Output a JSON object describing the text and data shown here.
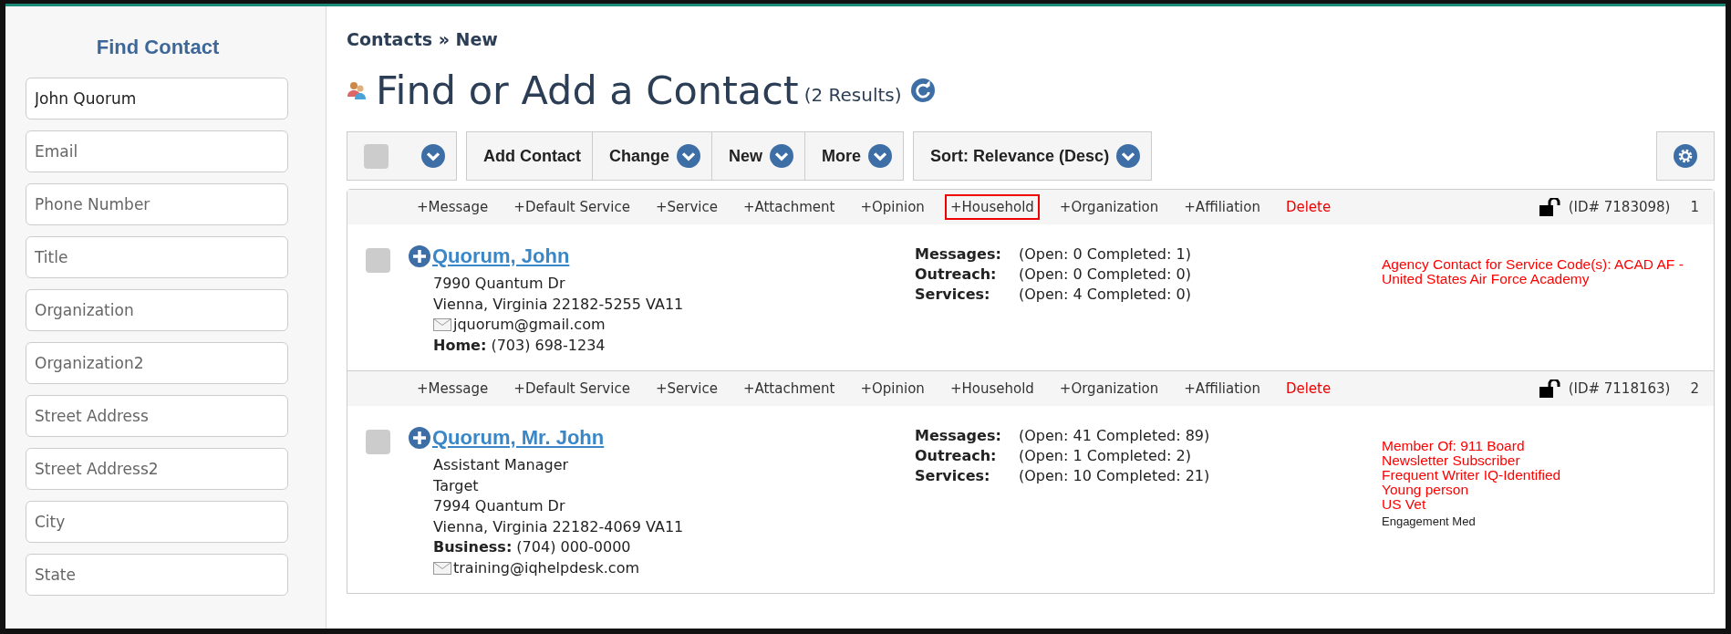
{
  "sidebar": {
    "title": "Find Contact",
    "fields": [
      {
        "value": "John Quorum"
      },
      {
        "placeholder": "Email"
      },
      {
        "placeholder": "Phone Number"
      },
      {
        "placeholder": "Title"
      },
      {
        "placeholder": "Organization"
      },
      {
        "placeholder": "Organization2"
      },
      {
        "placeholder": "Street Address"
      },
      {
        "placeholder": "Street Address2"
      },
      {
        "placeholder": "City"
      },
      {
        "placeholder": "State"
      }
    ]
  },
  "breadcrumb": "Contacts » New",
  "page_title": "Find or Add a Contact",
  "result_count": "(2 Results)",
  "toolbar": {
    "select_all_checked": false,
    "buttons": [
      {
        "label": "Add Contact",
        "dropdown": false
      },
      {
        "label": "Change",
        "dropdown": true
      },
      {
        "label": "New",
        "dropdown": true
      },
      {
        "label": "More",
        "dropdown": true
      }
    ],
    "sort": "Sort: Relevance (Desc)"
  },
  "contacts": [
    {
      "actions": [
        {
          "label": "+Message",
          "kind": "add",
          "highlighted": false
        },
        {
          "label": "+Default Service",
          "kind": "add",
          "highlighted": false
        },
        {
          "label": "+Service",
          "kind": "add",
          "highlighted": false
        },
        {
          "label": "+Attachment",
          "kind": "add",
          "highlighted": false
        },
        {
          "label": "+Opinion",
          "kind": "add",
          "highlighted": false
        },
        {
          "label": "+Household",
          "kind": "add",
          "highlighted": true
        },
        {
          "label": "+Organization",
          "kind": "add",
          "highlighted": false
        },
        {
          "label": "+Affiliation",
          "kind": "add",
          "highlighted": false
        },
        {
          "label": "Delete",
          "kind": "delete",
          "highlighted": false
        }
      ],
      "id": "(ID# 7183098)",
      "index": "1",
      "checked": false,
      "name": "Quorum, John",
      "details": [
        {
          "kind": "text",
          "text": "7990 Quantum Dr"
        },
        {
          "kind": "text",
          "text": "Vienna, Virginia 22182-5255 VA11"
        },
        {
          "kind": "email",
          "text": "jquorum@gmail.com"
        },
        {
          "kind": "phone",
          "label": "Home:",
          "text": "(703) 698-1234"
        }
      ],
      "stats": [
        {
          "label": "Messages:",
          "value": "(Open: 0 Completed: 1)"
        },
        {
          "label": "Outreach:",
          "value": "(Open: 0 Completed: 0)"
        },
        {
          "label": "Services:",
          "value": "(Open: 4 Completed: 0)"
        }
      ],
      "flags": [
        {
          "kind": "alert",
          "text": "Agency Contact for Service Code(s): ACAD AF - United States Air Force Academy"
        }
      ]
    },
    {
      "actions": [
        {
          "label": "+Message",
          "kind": "add",
          "highlighted": false
        },
        {
          "label": "+Default Service",
          "kind": "add",
          "highlighted": false
        },
        {
          "label": "+Service",
          "kind": "add",
          "highlighted": false
        },
        {
          "label": "+Attachment",
          "kind": "add",
          "highlighted": false
        },
        {
          "label": "+Opinion",
          "kind": "add",
          "highlighted": false
        },
        {
          "label": "+Household",
          "kind": "add",
          "highlighted": false
        },
        {
          "label": "+Organization",
          "kind": "add",
          "highlighted": false
        },
        {
          "label": "+Affiliation",
          "kind": "add",
          "highlighted": false
        },
        {
          "label": "Delete",
          "kind": "delete",
          "highlighted": false
        }
      ],
      "id": "(ID# 7118163)",
      "index": "2",
      "checked": false,
      "name": "Quorum, Mr. John",
      "details": [
        {
          "kind": "text",
          "text": "Assistant Manager"
        },
        {
          "kind": "text",
          "text": "Target"
        },
        {
          "kind": "text",
          "text": "7994 Quantum Dr"
        },
        {
          "kind": "text",
          "text": "Vienna, Virginia 22182-4069 VA11"
        },
        {
          "kind": "phone",
          "label": "Business:",
          "text": "(704) 000-0000"
        },
        {
          "kind": "email",
          "text": "training@iqhelpdesk.com"
        }
      ],
      "stats": [
        {
          "label": "Messages:",
          "value": "(Open: 41 Completed: 89)"
        },
        {
          "label": "Outreach:",
          "value": "(Open: 1 Completed: 2)"
        },
        {
          "label": "Services:",
          "value": "(Open: 10 Completed: 21)"
        }
      ],
      "flags": [
        {
          "kind": "alert",
          "text": "Member Of: 911 Board"
        },
        {
          "kind": "alert",
          "text": "Newsletter Subscriber"
        },
        {
          "kind": "alert",
          "text": "Frequent Writer IQ-Identified"
        },
        {
          "kind": "alert",
          "text": "Young person"
        },
        {
          "kind": "alert",
          "text": "US Vet"
        },
        {
          "kind": "note",
          "text": "Engagement Med"
        }
      ]
    }
  ]
}
